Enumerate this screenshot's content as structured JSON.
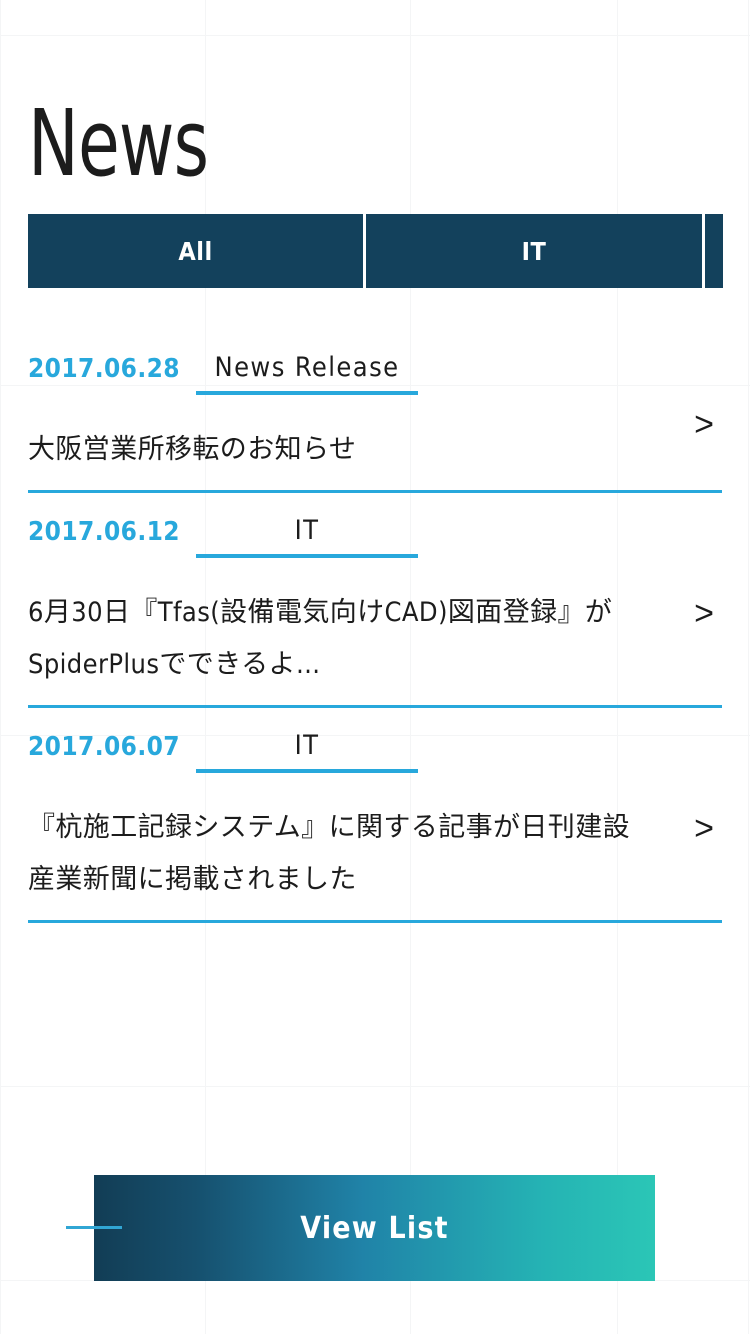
{
  "page": {
    "title": "News"
  },
  "tabs": [
    {
      "label": "All",
      "selected": true,
      "width_class": "w-all"
    },
    {
      "label": "IT",
      "selected": false,
      "width_class": "w-it"
    },
    {
      "label": "",
      "selected": false,
      "width_class": "w-cut"
    }
  ],
  "news": {
    "items": [
      {
        "date": "2017.06.28",
        "category": "News Release",
        "title": "大阪営業所移転のお知らせ",
        "arrow": ">"
      },
      {
        "date": "2017.06.12",
        "category": "IT",
        "title": "6月30日『Tfas(設備電気向けCAD)図面登録』がSpiderPlusでできるよ…",
        "arrow": ">"
      },
      {
        "date": "2017.06.07",
        "category": "IT",
        "title": "『杭施工記録システム』に関する記事が日刊建設産業新聞に掲載されました",
        "arrow": ">"
      }
    ]
  },
  "view_list": {
    "label": "View List"
  },
  "colors": {
    "accent_cyan": "#28a8dc",
    "tab_navy": "#13415c",
    "text_dark": "#1c1c1c",
    "gradient_start": "#123d55",
    "gradient_end": "#2bc6b6",
    "grid_line": "#f4f5f6"
  }
}
